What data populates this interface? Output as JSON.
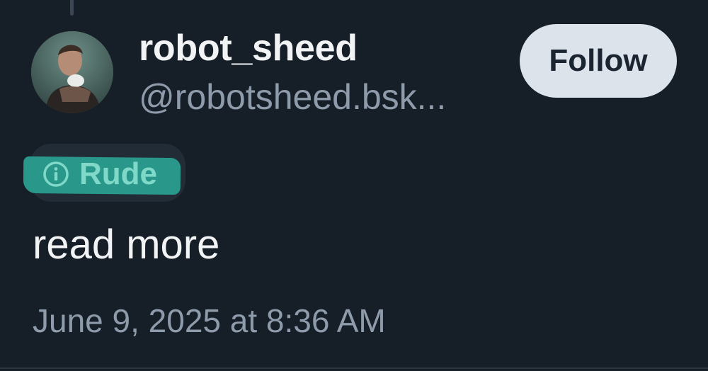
{
  "author": {
    "display_name": "robot_sheed",
    "handle": "@robotsheed.bsk...",
    "avatar": "profile-photo"
  },
  "follow_button": {
    "label": "Follow"
  },
  "content_label": {
    "icon": "info-icon",
    "text": "Rude",
    "highlight_color": "#2a9e8e"
  },
  "post": {
    "text": "read more",
    "timestamp": "June 9, 2025 at 8:36 AM"
  },
  "colors": {
    "background": "#161e27",
    "primary_text": "#f1f3f5",
    "secondary_text": "#8d9bab",
    "button_bg": "#dce3ea"
  }
}
